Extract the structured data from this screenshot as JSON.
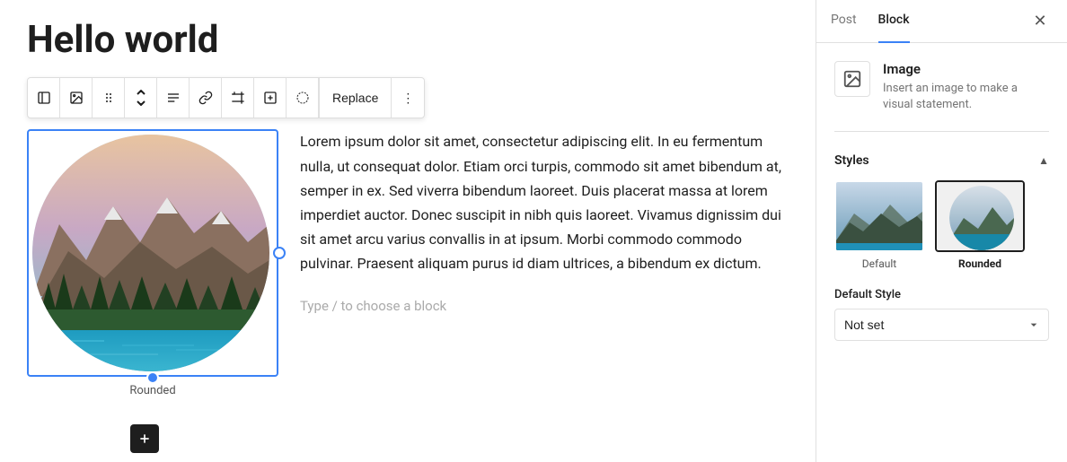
{
  "tabs": {
    "post": "Post",
    "block": "Block"
  },
  "title": "Hello world",
  "toolbar": {
    "replace_label": "Replace",
    "more_label": "⋮"
  },
  "image": {
    "caption": "Rounded"
  },
  "body_text": "Lorem ipsum dolor sit amet, consectetur adipiscing elit. In eu fermentum nulla, ut consequat dolor. Etiam orci turpis, commodo sit amet bibendum at, semper in ex. Sed viverra bibendum laoreet. Duis placerat massa at lorem imperdiet auctor. Donec suscipit in nibh quis laoreet. Vivamus dignissim dui sit amet arcu varius convallis in at ipsum. Morbi commodo commodo pulvinar. Praesent aliquam purus id diam ultrices, a bibendum ex dictum.",
  "type_hint": "Type / to choose a block",
  "sidebar": {
    "block_info": {
      "title": "Image",
      "description": "Insert an image to make a visual statement."
    },
    "styles_title": "Styles",
    "style_options": [
      {
        "label": "Default",
        "selected": false
      },
      {
        "label": "Rounded",
        "selected": true
      }
    ],
    "default_style_label": "Default Style",
    "default_style_options": [
      {
        "value": "not-set",
        "label": "Not set"
      }
    ],
    "default_style_value": "Not set"
  }
}
